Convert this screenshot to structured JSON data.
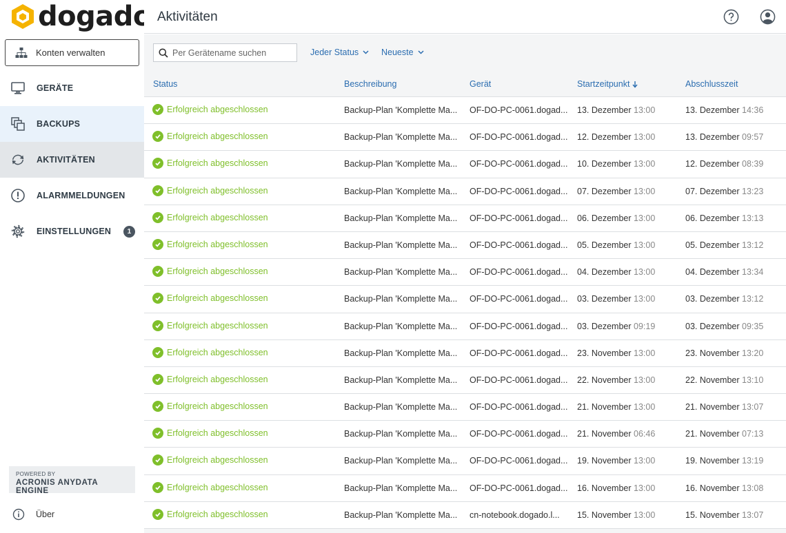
{
  "brand": {
    "name": "dogado"
  },
  "sidebar": {
    "konten_label": "Konten verwalten",
    "items": [
      {
        "label": "GERÄTE",
        "icon": "monitor-icon"
      },
      {
        "label": "BACKUPS",
        "icon": "backups-icon"
      },
      {
        "label": "AKTIVITÄTEN",
        "icon": "activity-icon"
      },
      {
        "label": "ALARMMELDUNGEN",
        "icon": "alert-icon"
      },
      {
        "label": "EINSTELLUNGEN",
        "icon": "gear-icon",
        "badge": "1"
      }
    ],
    "powered_by": "POWERED BY",
    "engine": "ACRONIS ANYDATA ENGINE",
    "about": "Über"
  },
  "header": {
    "title": "Aktivitäten"
  },
  "toolbar": {
    "search_placeholder": "Per Gerätename suchen",
    "status_filter": "Jeder Status",
    "sort": "Neueste"
  },
  "table": {
    "columns": [
      "Status",
      "Beschreibung",
      "Gerät",
      "Startzeitpunkt",
      "Abschlusszeit"
    ],
    "rows": [
      {
        "status": "Erfolgreich abgeschlossen",
        "desc": "Backup-Plan 'Komplette Ma...",
        "device": "OF-DO-PC-0061.dogad...",
        "start_date": "13. Dezember",
        "start_time": "13:00",
        "end_date": "13. Dezember",
        "end_time": "14:36"
      },
      {
        "status": "Erfolgreich abgeschlossen",
        "desc": "Backup-Plan 'Komplette Ma...",
        "device": "OF-DO-PC-0061.dogad...",
        "start_date": "12. Dezember",
        "start_time": "13:00",
        "end_date": "13. Dezember",
        "end_time": "09:57"
      },
      {
        "status": "Erfolgreich abgeschlossen",
        "desc": "Backup-Plan 'Komplette Ma...",
        "device": "OF-DO-PC-0061.dogad...",
        "start_date": "10. Dezember",
        "start_time": "13:00",
        "end_date": "12. Dezember",
        "end_time": "08:39"
      },
      {
        "status": "Erfolgreich abgeschlossen",
        "desc": "Backup-Plan 'Komplette Ma...",
        "device": "OF-DO-PC-0061.dogad...",
        "start_date": "07. Dezember",
        "start_time": "13:00",
        "end_date": "07. Dezember",
        "end_time": "13:23"
      },
      {
        "status": "Erfolgreich abgeschlossen",
        "desc": "Backup-Plan 'Komplette Ma...",
        "device": "OF-DO-PC-0061.dogad...",
        "start_date": "06. Dezember",
        "start_time": "13:00",
        "end_date": "06. Dezember",
        "end_time": "13:13"
      },
      {
        "status": "Erfolgreich abgeschlossen",
        "desc": "Backup-Plan 'Komplette Ma...",
        "device": "OF-DO-PC-0061.dogad...",
        "start_date": "05. Dezember",
        "start_time": "13:00",
        "end_date": "05. Dezember",
        "end_time": "13:12"
      },
      {
        "status": "Erfolgreich abgeschlossen",
        "desc": "Backup-Plan 'Komplette Ma...",
        "device": "OF-DO-PC-0061.dogad...",
        "start_date": "04. Dezember",
        "start_time": "13:00",
        "end_date": "04. Dezember",
        "end_time": "13:34"
      },
      {
        "status": "Erfolgreich abgeschlossen",
        "desc": "Backup-Plan 'Komplette Ma...",
        "device": "OF-DO-PC-0061.dogad...",
        "start_date": "03. Dezember",
        "start_time": "13:00",
        "end_date": "03. Dezember",
        "end_time": "13:12"
      },
      {
        "status": "Erfolgreich abgeschlossen",
        "desc": "Backup-Plan 'Komplette Ma...",
        "device": "OF-DO-PC-0061.dogad...",
        "start_date": "03. Dezember",
        "start_time": "09:19",
        "end_date": "03. Dezember",
        "end_time": "09:35"
      },
      {
        "status": "Erfolgreich abgeschlossen",
        "desc": "Backup-Plan 'Komplette Ma...",
        "device": "OF-DO-PC-0061.dogad...",
        "start_date": "23. November",
        "start_time": "13:00",
        "end_date": "23. November",
        "end_time": "13:20"
      },
      {
        "status": "Erfolgreich abgeschlossen",
        "desc": "Backup-Plan 'Komplette Ma...",
        "device": "OF-DO-PC-0061.dogad...",
        "start_date": "22. November",
        "start_time": "13:00",
        "end_date": "22. November",
        "end_time": "13:10"
      },
      {
        "status": "Erfolgreich abgeschlossen",
        "desc": "Backup-Plan 'Komplette Ma...",
        "device": "OF-DO-PC-0061.dogad...",
        "start_date": "21. November",
        "start_time": "13:00",
        "end_date": "21. November",
        "end_time": "13:07"
      },
      {
        "status": "Erfolgreich abgeschlossen",
        "desc": "Backup-Plan 'Komplette Ma...",
        "device": "OF-DO-PC-0061.dogad...",
        "start_date": "21. November",
        "start_time": "06:46",
        "end_date": "21. November",
        "end_time": "07:13"
      },
      {
        "status": "Erfolgreich abgeschlossen",
        "desc": "Backup-Plan 'Komplette Ma...",
        "device": "OF-DO-PC-0061.dogad...",
        "start_date": "19. November",
        "start_time": "13:00",
        "end_date": "19. November",
        "end_time": "13:19"
      },
      {
        "status": "Erfolgreich abgeschlossen",
        "desc": "Backup-Plan 'Komplette Ma...",
        "device": "OF-DO-PC-0061.dogad...",
        "start_date": "16. November",
        "start_time": "13:00",
        "end_date": "16. November",
        "end_time": "13:08"
      },
      {
        "status": "Erfolgreich abgeschlossen",
        "desc": "Backup-Plan 'Komplette Ma...",
        "device": "cn-notebook.dogado.l...",
        "start_date": "15. November",
        "start_time": "13:00",
        "end_date": "15. November",
        "end_time": "13:07"
      }
    ]
  },
  "colors": {
    "accent": "#2b6db0",
    "success": "#7fbf2a",
    "brand_yellow": "#f5b301"
  }
}
